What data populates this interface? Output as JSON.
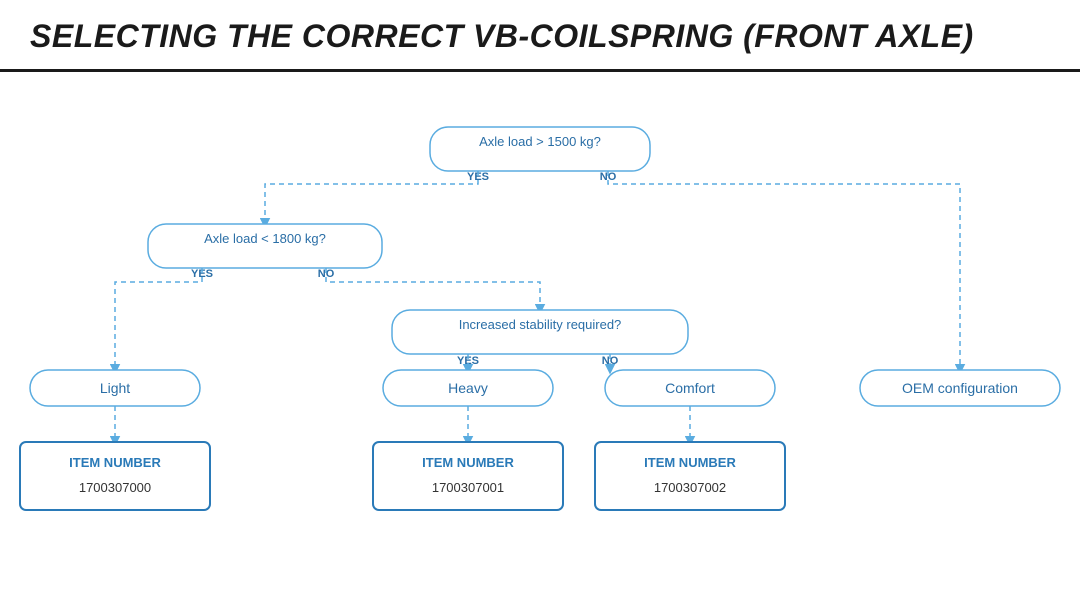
{
  "page": {
    "title": "SELECTING THE CORRECT VB-CoilSpring (FRONT AXLE)"
  },
  "decisions": [
    {
      "id": "d1",
      "label": "Axle load > 1500 kg?",
      "yes": "d2",
      "no": "oem"
    },
    {
      "id": "d2",
      "label": "Axle load < 1800 kg?",
      "yes": "light",
      "no": "d3"
    },
    {
      "id": "d3",
      "label": "Increased stability required?",
      "yes": "heavy",
      "no": "comfort"
    }
  ],
  "outcomes": [
    {
      "id": "light",
      "label": "Light",
      "item_label": "ITEM NUMBER",
      "item_number": "1700307000"
    },
    {
      "id": "heavy",
      "label": "Heavy",
      "item_label": "ITEM NUMBER",
      "item_number": "1700307001"
    },
    {
      "id": "comfort",
      "label": "Comfort",
      "item_label": "ITEM NUMBER",
      "item_number": "1700307002"
    },
    {
      "id": "oem",
      "label": "OEM configuration"
    }
  ],
  "labels": {
    "yes": "YES",
    "no": "NO"
  }
}
